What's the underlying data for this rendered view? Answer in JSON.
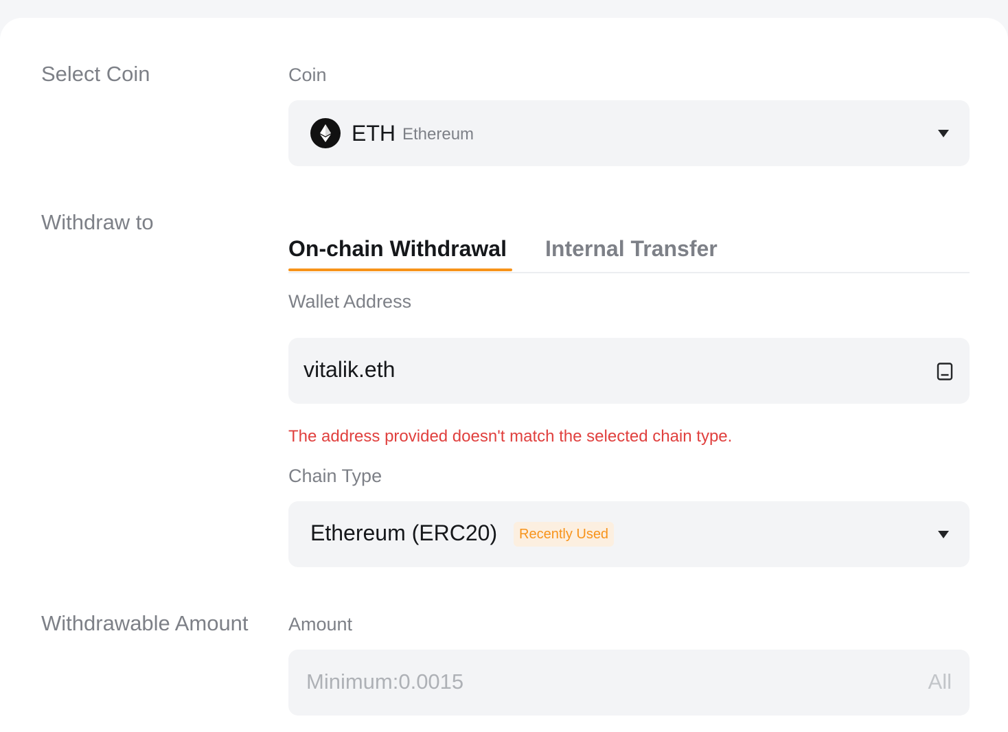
{
  "sections": {
    "select_coin": "Select Coin",
    "withdraw_to": "Withdraw to",
    "withdrawable_amount": "Withdrawable Amount"
  },
  "coin": {
    "label": "Coin",
    "symbol": "ETH",
    "name": "Ethereum",
    "icon": "ethereum-icon"
  },
  "tabs": [
    {
      "label": "On-chain Withdrawal",
      "active": true
    },
    {
      "label": "Internal Transfer",
      "active": false
    }
  ],
  "wallet": {
    "label": "Wallet Address",
    "value": "vitalik.eth",
    "error": "The address provided doesn't match the selected chain type.",
    "icon": "address-book-icon"
  },
  "chain": {
    "label": "Chain Type",
    "value": "Ethereum (ERC20)",
    "badge": "Recently Used"
  },
  "amount": {
    "label": "Amount",
    "placeholder": "Minimum:0.0015",
    "all_label": "All"
  },
  "colors": {
    "accent": "#f7931a",
    "error": "#e0403e",
    "field_bg": "#f3f4f6"
  }
}
